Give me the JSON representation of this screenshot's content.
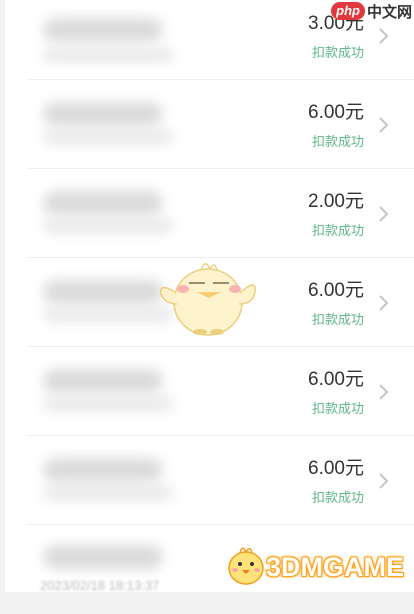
{
  "watermark_top": {
    "php": "php",
    "suffix": "中文网"
  },
  "records": [
    {
      "amount": "3.00元",
      "status": "扣款成功"
    },
    {
      "amount": "6.00元",
      "status": "扣款成功"
    },
    {
      "amount": "2.00元",
      "status": "扣款成功"
    },
    {
      "amount": "6.00元",
      "status": "扣款成功"
    },
    {
      "amount": "6.00元",
      "status": "扣款成功"
    },
    {
      "amount": "6.00元",
      "status": "扣款成功"
    }
  ],
  "bottom_date": "2023/02/18 18:13:37",
  "brand_watermark": "3DMGAME",
  "colors": {
    "status": "#61b58a",
    "amount": "#333333",
    "chevron": "#c4c4c4"
  }
}
